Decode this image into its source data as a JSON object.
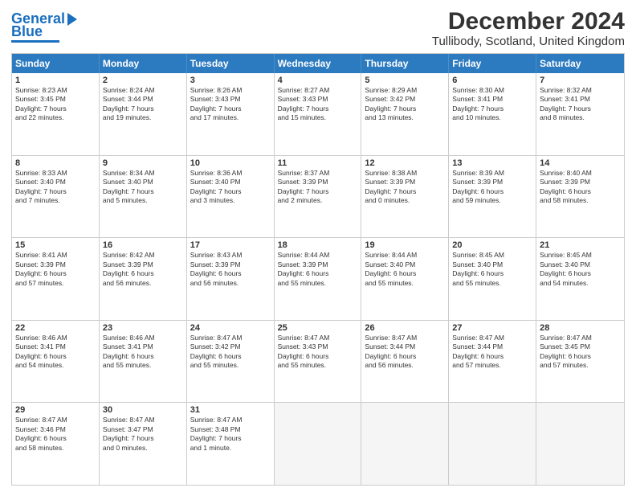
{
  "logo": {
    "line1": "General",
    "line2": "Blue"
  },
  "header": {
    "month": "December 2024",
    "location": "Tullibody, Scotland, United Kingdom"
  },
  "days": [
    "Sunday",
    "Monday",
    "Tuesday",
    "Wednesday",
    "Thursday",
    "Friday",
    "Saturday"
  ],
  "rows": [
    [
      {
        "day": "1",
        "lines": [
          "Sunrise: 8:23 AM",
          "Sunset: 3:45 PM",
          "Daylight: 7 hours",
          "and 22 minutes."
        ]
      },
      {
        "day": "2",
        "lines": [
          "Sunrise: 8:24 AM",
          "Sunset: 3:44 PM",
          "Daylight: 7 hours",
          "and 19 minutes."
        ]
      },
      {
        "day": "3",
        "lines": [
          "Sunrise: 8:26 AM",
          "Sunset: 3:43 PM",
          "Daylight: 7 hours",
          "and 17 minutes."
        ]
      },
      {
        "day": "4",
        "lines": [
          "Sunrise: 8:27 AM",
          "Sunset: 3:43 PM",
          "Daylight: 7 hours",
          "and 15 minutes."
        ]
      },
      {
        "day": "5",
        "lines": [
          "Sunrise: 8:29 AM",
          "Sunset: 3:42 PM",
          "Daylight: 7 hours",
          "and 13 minutes."
        ]
      },
      {
        "day": "6",
        "lines": [
          "Sunrise: 8:30 AM",
          "Sunset: 3:41 PM",
          "Daylight: 7 hours",
          "and 10 minutes."
        ]
      },
      {
        "day": "7",
        "lines": [
          "Sunrise: 8:32 AM",
          "Sunset: 3:41 PM",
          "Daylight: 7 hours",
          "and 8 minutes."
        ]
      }
    ],
    [
      {
        "day": "8",
        "lines": [
          "Sunrise: 8:33 AM",
          "Sunset: 3:40 PM",
          "Daylight: 7 hours",
          "and 7 minutes."
        ]
      },
      {
        "day": "9",
        "lines": [
          "Sunrise: 8:34 AM",
          "Sunset: 3:40 PM",
          "Daylight: 7 hours",
          "and 5 minutes."
        ]
      },
      {
        "day": "10",
        "lines": [
          "Sunrise: 8:36 AM",
          "Sunset: 3:40 PM",
          "Daylight: 7 hours",
          "and 3 minutes."
        ]
      },
      {
        "day": "11",
        "lines": [
          "Sunrise: 8:37 AM",
          "Sunset: 3:39 PM",
          "Daylight: 7 hours",
          "and 2 minutes."
        ]
      },
      {
        "day": "12",
        "lines": [
          "Sunrise: 8:38 AM",
          "Sunset: 3:39 PM",
          "Daylight: 7 hours",
          "and 0 minutes."
        ]
      },
      {
        "day": "13",
        "lines": [
          "Sunrise: 8:39 AM",
          "Sunset: 3:39 PM",
          "Daylight: 6 hours",
          "and 59 minutes."
        ]
      },
      {
        "day": "14",
        "lines": [
          "Sunrise: 8:40 AM",
          "Sunset: 3:39 PM",
          "Daylight: 6 hours",
          "and 58 minutes."
        ]
      }
    ],
    [
      {
        "day": "15",
        "lines": [
          "Sunrise: 8:41 AM",
          "Sunset: 3:39 PM",
          "Daylight: 6 hours",
          "and 57 minutes."
        ]
      },
      {
        "day": "16",
        "lines": [
          "Sunrise: 8:42 AM",
          "Sunset: 3:39 PM",
          "Daylight: 6 hours",
          "and 56 minutes."
        ]
      },
      {
        "day": "17",
        "lines": [
          "Sunrise: 8:43 AM",
          "Sunset: 3:39 PM",
          "Daylight: 6 hours",
          "and 56 minutes."
        ]
      },
      {
        "day": "18",
        "lines": [
          "Sunrise: 8:44 AM",
          "Sunset: 3:39 PM",
          "Daylight: 6 hours",
          "and 55 minutes."
        ]
      },
      {
        "day": "19",
        "lines": [
          "Sunrise: 8:44 AM",
          "Sunset: 3:40 PM",
          "Daylight: 6 hours",
          "and 55 minutes."
        ]
      },
      {
        "day": "20",
        "lines": [
          "Sunrise: 8:45 AM",
          "Sunset: 3:40 PM",
          "Daylight: 6 hours",
          "and 55 minutes."
        ]
      },
      {
        "day": "21",
        "lines": [
          "Sunrise: 8:45 AM",
          "Sunset: 3:40 PM",
          "Daylight: 6 hours",
          "and 54 minutes."
        ]
      }
    ],
    [
      {
        "day": "22",
        "lines": [
          "Sunrise: 8:46 AM",
          "Sunset: 3:41 PM",
          "Daylight: 6 hours",
          "and 54 minutes."
        ]
      },
      {
        "day": "23",
        "lines": [
          "Sunrise: 8:46 AM",
          "Sunset: 3:41 PM",
          "Daylight: 6 hours",
          "and 55 minutes."
        ]
      },
      {
        "day": "24",
        "lines": [
          "Sunrise: 8:47 AM",
          "Sunset: 3:42 PM",
          "Daylight: 6 hours",
          "and 55 minutes."
        ]
      },
      {
        "day": "25",
        "lines": [
          "Sunrise: 8:47 AM",
          "Sunset: 3:43 PM",
          "Daylight: 6 hours",
          "and 55 minutes."
        ]
      },
      {
        "day": "26",
        "lines": [
          "Sunrise: 8:47 AM",
          "Sunset: 3:44 PM",
          "Daylight: 6 hours",
          "and 56 minutes."
        ]
      },
      {
        "day": "27",
        "lines": [
          "Sunrise: 8:47 AM",
          "Sunset: 3:44 PM",
          "Daylight: 6 hours",
          "and 57 minutes."
        ]
      },
      {
        "day": "28",
        "lines": [
          "Sunrise: 8:47 AM",
          "Sunset: 3:45 PM",
          "Daylight: 6 hours",
          "and 57 minutes."
        ]
      }
    ],
    [
      {
        "day": "29",
        "lines": [
          "Sunrise: 8:47 AM",
          "Sunset: 3:46 PM",
          "Daylight: 6 hours",
          "and 58 minutes."
        ]
      },
      {
        "day": "30",
        "lines": [
          "Sunrise: 8:47 AM",
          "Sunset: 3:47 PM",
          "Daylight: 7 hours",
          "and 0 minutes."
        ]
      },
      {
        "day": "31",
        "lines": [
          "Sunrise: 8:47 AM",
          "Sunset: 3:48 PM",
          "Daylight: 7 hours",
          "and 1 minute."
        ]
      },
      {
        "day": "",
        "lines": []
      },
      {
        "day": "",
        "lines": []
      },
      {
        "day": "",
        "lines": []
      },
      {
        "day": "",
        "lines": []
      }
    ]
  ]
}
